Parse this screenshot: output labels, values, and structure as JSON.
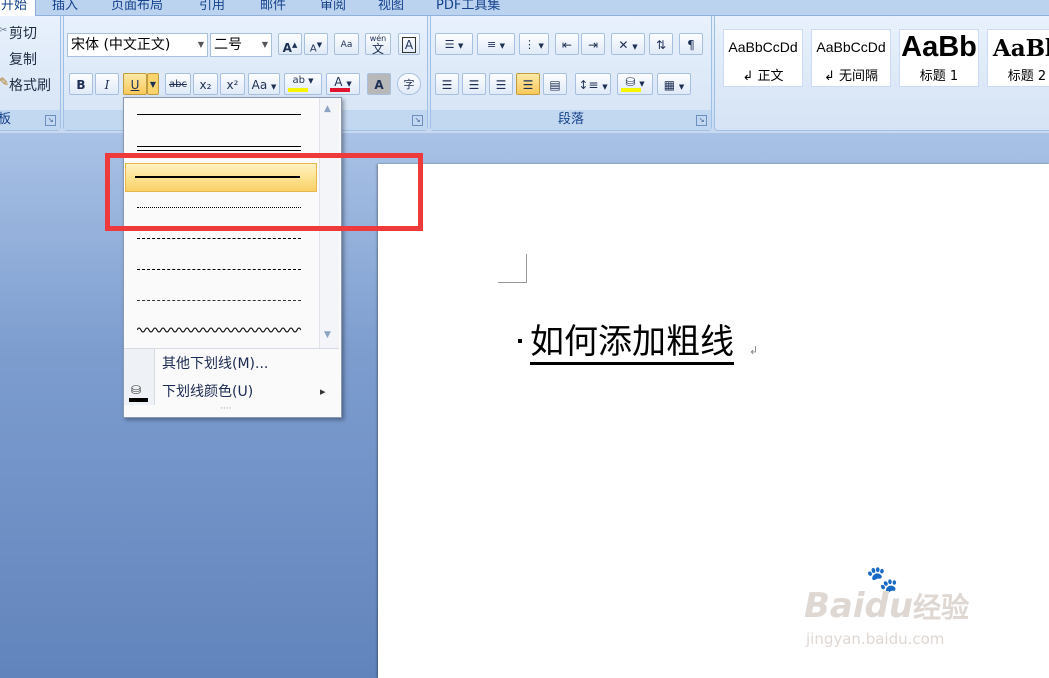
{
  "tabs": [
    "开始",
    "插入",
    "页面布局",
    "引用",
    "邮件",
    "审阅",
    "视图",
    "PDF工具集"
  ],
  "clipboard": {
    "cut": "剪切",
    "copy": "复制",
    "format_painter": "格式刷",
    "label": "板"
  },
  "font": {
    "name": "宋体 (中文正文)",
    "size": "二号",
    "grow": "A",
    "shrink": "A",
    "bold": "B",
    "italic": "I",
    "underline": "U",
    "strikethrough": "abc",
    "subscript": "x₂",
    "superscript": "x²",
    "change_case": "Aa",
    "highlight": "ab",
    "font_color": "A",
    "char_shading": "A",
    "enclose": "字",
    "phonetic": "wén",
    "phonetic_char": "文",
    "border_char": "A",
    "clear": "Aa"
  },
  "paragraph": {
    "label": "段落"
  },
  "styles": [
    {
      "sample": "AaBbCcDd",
      "label": "↲ 正文"
    },
    {
      "sample": "AaBbCcDd",
      "label": "↲ 无间隔"
    },
    {
      "sample": "AaBb",
      "label": "标题 1"
    },
    {
      "sample": "AaBb",
      "label": "标题 2"
    }
  ],
  "underline_menu": {
    "more": "其他下划线(M)...",
    "color": "下划线颜色(U)",
    "submenu_arrow": "▸",
    "grip": "····"
  },
  "document": {
    "text": "如何添加粗线"
  },
  "watermark": {
    "brand": "Bai",
    "brand_suffix": "du",
    "brand_cn": "经验",
    "url": "jingyan.baidu.com"
  },
  "colors": {
    "highlight_box": "#ee3a3a",
    "selected_item": "#fde08a",
    "font_color_bar": "#e0142c",
    "highlight_bar": "#f6f600"
  }
}
